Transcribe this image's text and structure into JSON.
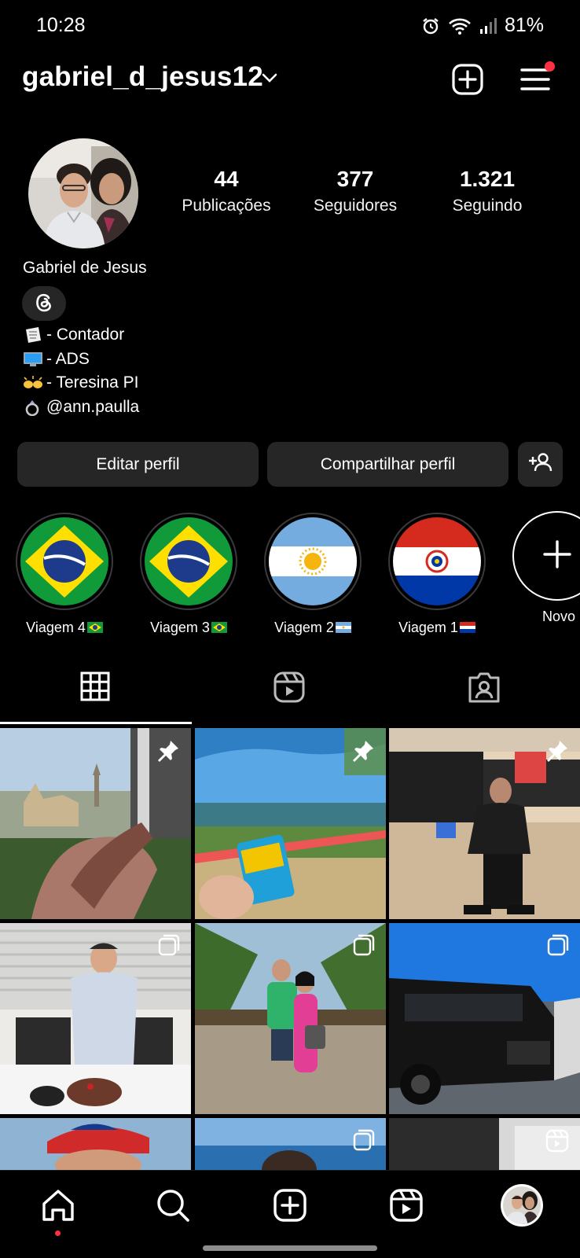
{
  "status": {
    "time": "10:28",
    "battery": "81%"
  },
  "profile": {
    "username": "gabriel_d_jesus12",
    "full_name": "Gabriel de Jesus",
    "bio": [
      "- Contador",
      " - ADS",
      "- Teresina PI",
      "@ann.paulla"
    ]
  },
  "stats": [
    {
      "count": "44",
      "label": "Publicações"
    },
    {
      "count": "377",
      "label": "Seguidores"
    },
    {
      "count": "1.321",
      "label": "Seguindo"
    }
  ],
  "buttons": {
    "edit": "Editar perfil",
    "share": "Compartilhar perfil"
  },
  "highlights": [
    {
      "label": "Viagem 4",
      "flag": "brazil"
    },
    {
      "label": "Viagem 3",
      "flag": "brazil"
    },
    {
      "label": "Viagem 2",
      "flag": "argentina"
    },
    {
      "label": "Viagem 1",
      "flag": "paraguay"
    }
  ],
  "new_highlight_label": "Novo",
  "tabs": [
    "grid-icon",
    "reels-icon",
    "tagged-icon"
  ],
  "colors": {
    "accent_red": "#ff3040",
    "button_bg": "#262626"
  }
}
